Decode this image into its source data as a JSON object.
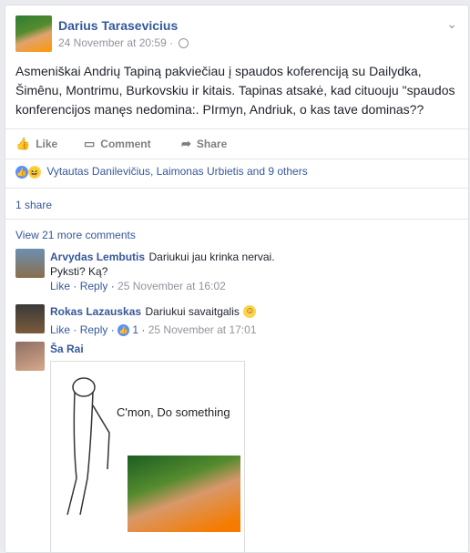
{
  "post": {
    "author": "Darius Tarasevicius",
    "timestamp": "24 November at 20:59",
    "privacy_icon": "globe-icon",
    "text": "Asmeniškai Andrių Tapiną pakviečiau į spaudos koferenciją su Dailydka, Šimênu, Montrimu, Burkovskiu ir kitais. Tapinas atsakė, kad cituouju \"spaudos konferencijos manęs nedomina:. PIrmyn, Andriuk, o kas tave dominas??"
  },
  "actions": {
    "like": "Like",
    "comment": "Comment",
    "share": "Share"
  },
  "reactions": {
    "names": "Vytautas Danilevičius, Laimonas Urbietis and 9 others"
  },
  "shares": "1 share",
  "view_more": "View 21 more comments",
  "comments": [
    {
      "name": "Arvydas Lembutis",
      "text": "Dariukui jau krinka nervai.",
      "text2": "Pyksti? Ką?",
      "like": "Like",
      "reply": "Reply",
      "time": "25 November at 16:02"
    },
    {
      "name": "Rokas Lazauskas",
      "text": "Dariukui savaitgalis",
      "like": "Like",
      "reply": "Reply",
      "likes": "1",
      "time": "25 November at 17:01"
    },
    {
      "name": "Ša Rai",
      "meme_text": "C'mon, Do something"
    }
  ],
  "colors": {
    "link": "#365899",
    "text": "#1d2129",
    "muted": "#90949c"
  }
}
